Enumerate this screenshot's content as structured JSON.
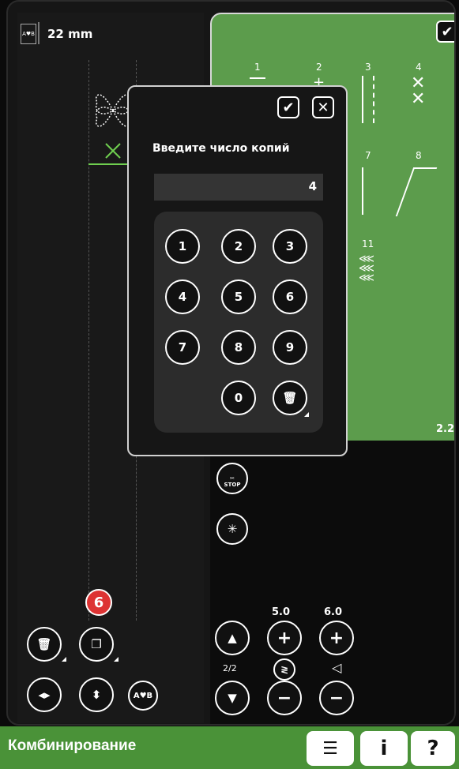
{
  "header": {
    "width_label": "22 mm",
    "width_icon": "width-adjust-icon"
  },
  "green_panel": {
    "confirm_icon": "checkmark-icon",
    "stitch_numbers": [
      "1",
      "2",
      "3",
      "4",
      "7",
      "8",
      "11"
    ],
    "page_label": "2.2"
  },
  "dialog": {
    "title": "Введите число копий",
    "value": "4",
    "confirm_icon": "checkmark-icon",
    "close_icon": "close-icon",
    "keys": [
      "1",
      "2",
      "3",
      "4",
      "5",
      "6",
      "7",
      "8",
      "9",
      "0"
    ],
    "delete_icon": "trash-icon"
  },
  "controls": {
    "stop_label": "STOP",
    "page_indicator": "2/2",
    "width_value": "5.0",
    "length_value": "6.0",
    "plus": "+",
    "minus": "−"
  },
  "left_tools": {
    "badge": "6",
    "ab_label": "A♥B"
  },
  "bottom_bar": {
    "title": "Комбинирование",
    "info_label": "i",
    "help_label": "?"
  },
  "colors": {
    "accent_green": "#5c9c4c",
    "bar_green": "#4a9238",
    "badge_red": "#d33333"
  }
}
